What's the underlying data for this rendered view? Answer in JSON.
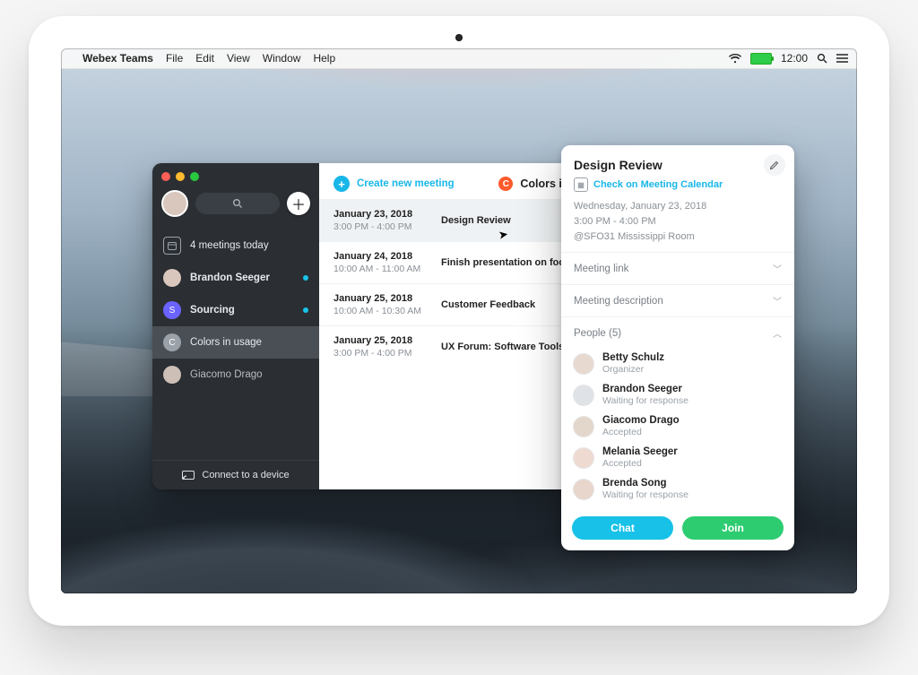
{
  "menubar": {
    "app": "Webex Teams",
    "items": [
      "File",
      "Edit",
      "View",
      "Window",
      "Help"
    ],
    "clock": "12:00"
  },
  "sidebar": {
    "meetings_today": "4 meetings today",
    "items": [
      {
        "label": "Brandon Seeger",
        "color": "#d9c7bd",
        "dot": "#18c4ea"
      },
      {
        "label": "Sourcing",
        "letter": "S",
        "lcolor": "#6b63ff",
        "dot": "#18c4ea"
      },
      {
        "label": "Colors in usage",
        "letter": "C",
        "lcolor": "#ff5a2b",
        "selected": true
      },
      {
        "label": "Giacomo Drago",
        "color": "#cdbfb6"
      }
    ],
    "connect": "Connect to a device"
  },
  "main": {
    "create_label": "Create new meeting",
    "crumb": {
      "title": "Colors in usage"
    },
    "meetings": [
      {
        "date": "January 23, 2018",
        "time": "3:00 PM - 4:00 PM",
        "title": "Design Review",
        "selected": true
      },
      {
        "date": "January 24, 2018",
        "time": "10:00 AM - 11:00 AM",
        "title": "Finish presentation on focus areas"
      },
      {
        "date": "January 25, 2018",
        "time": "10:00 AM - 10:30 AM",
        "title": "Customer Feedback"
      },
      {
        "date": "January 25, 2018",
        "time": "3:00 PM - 4:00 PM",
        "title": "UX Forum: Software Tools Discussion"
      }
    ]
  },
  "popover": {
    "title": "Design Review",
    "calendar_link": "Check on Meeting Calendar",
    "date_line": "Wednesday, January 23, 2018",
    "time_line": "3:00 PM - 4:00 PM",
    "room_line": "@SFO31 Mississippi Room",
    "sections": {
      "link": "Meeting link",
      "desc": "Meeting description",
      "people": "People (5)"
    },
    "people": [
      {
        "name": "Betty Schulz",
        "status": "Organizer"
      },
      {
        "name": "Brandon Seeger",
        "status": "Waiting for response"
      },
      {
        "name": "Giacomo Drago",
        "status": "Accepted"
      },
      {
        "name": "Melania Seeger",
        "status": "Accepted"
      },
      {
        "name": "Brenda Song",
        "status": "Waiting for response"
      }
    ],
    "chat_label": "Chat",
    "join_label": "Join"
  }
}
